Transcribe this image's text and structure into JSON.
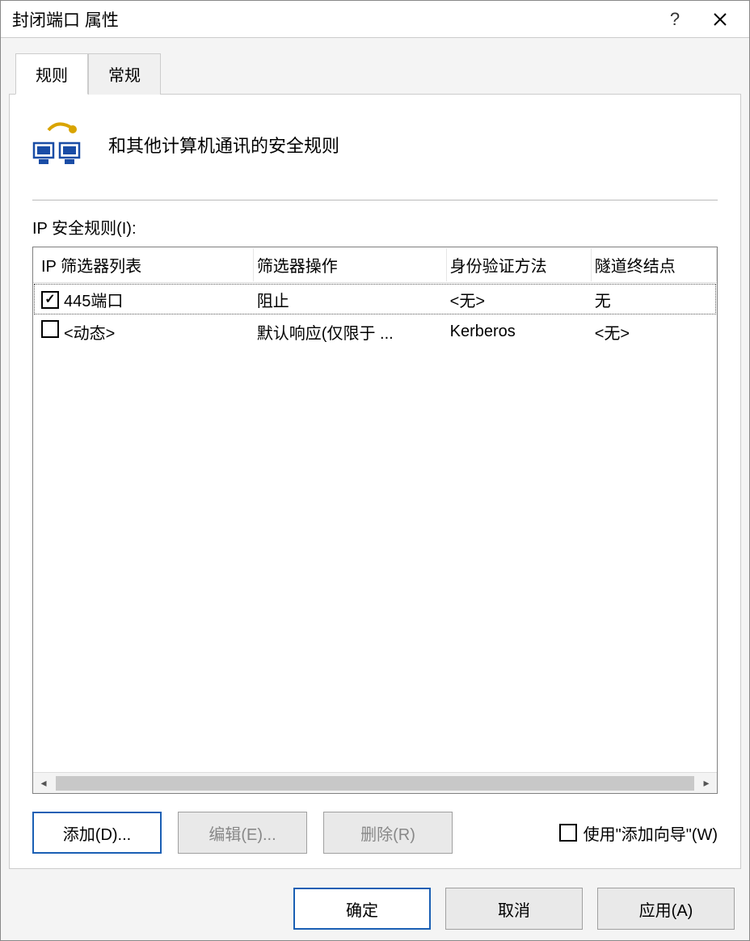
{
  "title": "封闭端口 属性",
  "tabs": {
    "rules": "规则",
    "general": "常规"
  },
  "header": {
    "desc": "和其他计算机通讯的安全规则"
  },
  "section_label": "IP 安全规则(I):",
  "columns": {
    "filter_list": "IP 筛选器列表",
    "filter_action": "筛选器操作",
    "auth_method": "身份验证方法",
    "tunnel_endpoint": "隧道终结点"
  },
  "rows": [
    {
      "checked": true,
      "filter_list": "445端口",
      "filter_action": "阻止",
      "auth_method": "<无>",
      "tunnel_endpoint": "无",
      "selected": true
    },
    {
      "checked": false,
      "filter_list": "<动态>",
      "filter_action": "默认响应(仅限于 ...",
      "auth_method": "Kerberos",
      "tunnel_endpoint": "<无>",
      "selected": false
    }
  ],
  "buttons": {
    "add": "添加(D)...",
    "edit": "编辑(E)...",
    "delete": "删除(R)",
    "use_wizard": "使用\"添加向导\"(W)",
    "ok": "确定",
    "cancel": "取消",
    "apply": "应用(A)"
  }
}
